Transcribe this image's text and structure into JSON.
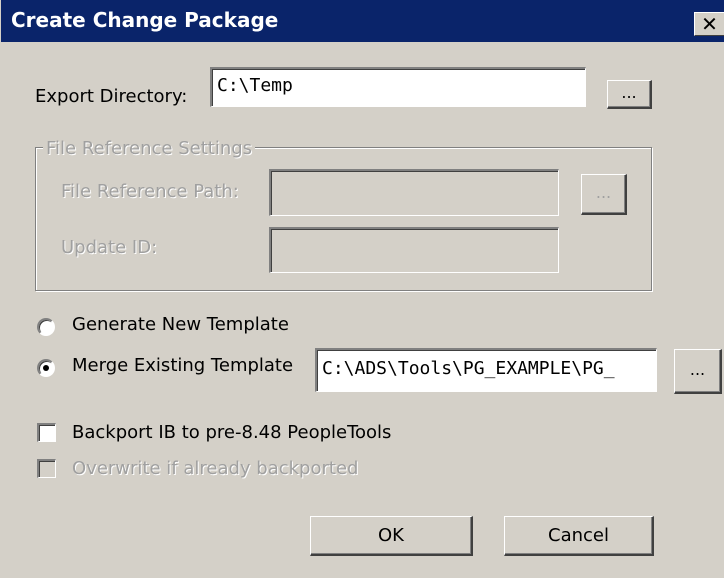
{
  "window": {
    "title": "Create Change Package",
    "close_glyph": "✕"
  },
  "export": {
    "label": "Export Directory:",
    "value": "C:\\Temp",
    "browse_label": "..."
  },
  "file_ref": {
    "group_label": "File Reference Settings",
    "path_label": "File Reference Path:",
    "path_value": "",
    "path_browse_label": "...",
    "update_label": "Update ID:",
    "update_value": ""
  },
  "template": {
    "generate_label": "Generate New Template",
    "generate_selected": false,
    "merge_label": "Merge Existing Template",
    "merge_selected": true,
    "merge_value": "C:\\ADS\\Tools\\PG_EXAMPLE\\PG_",
    "merge_browse_label": "..."
  },
  "options": {
    "backport_label": "Backport IB to pre-8.48 PeopleTools",
    "backport_checked": false,
    "overwrite_label": "Overwrite if already backported",
    "overwrite_checked": false,
    "overwrite_enabled": false
  },
  "buttons": {
    "ok": "OK",
    "cancel": "Cancel"
  },
  "colors": {
    "titlebar": "#0a246a",
    "face": "#d4d0c8",
    "disabled_text": "#a0a0a0"
  }
}
